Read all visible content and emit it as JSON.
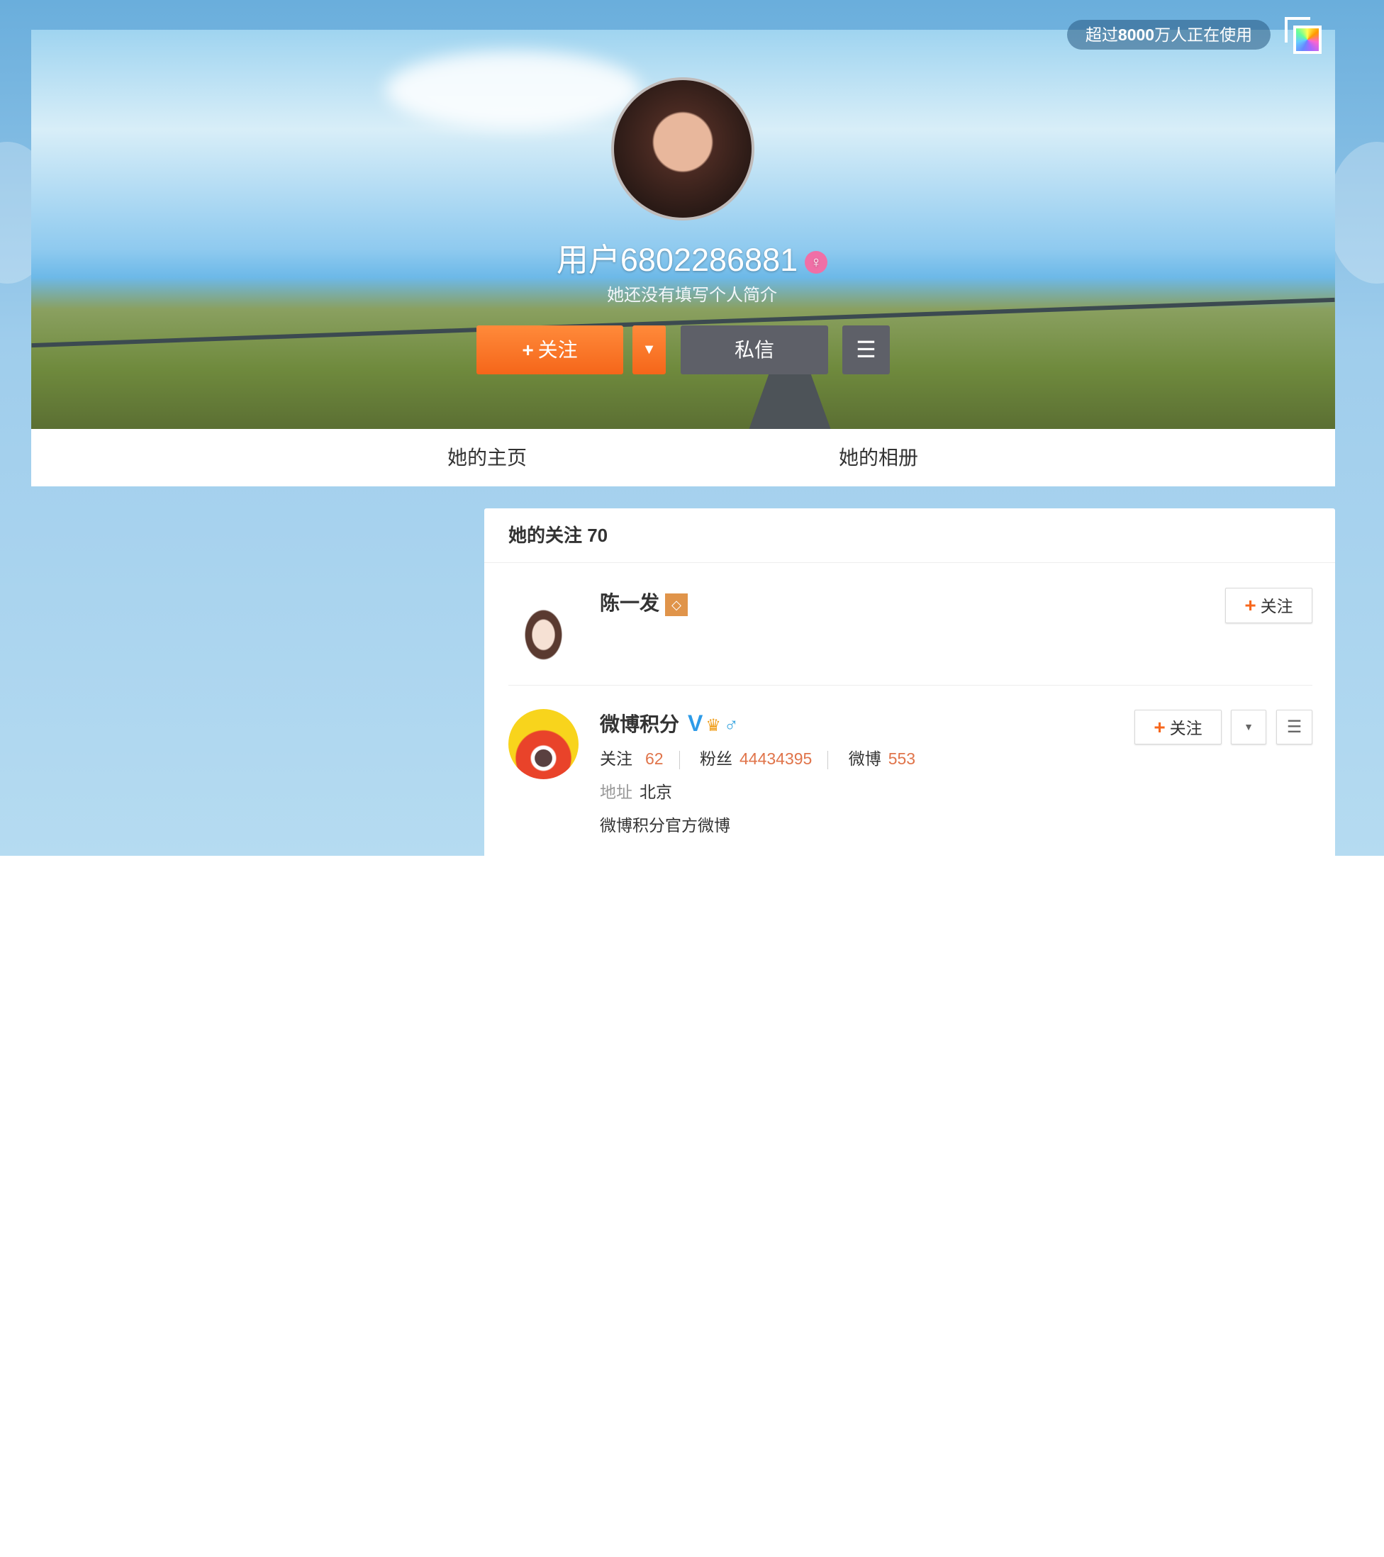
{
  "top": {
    "badge_prefix": "超过",
    "badge_count": "8000",
    "badge_suffix": "万人正在使用"
  },
  "profile": {
    "name": "用户6802286881",
    "gender": "♀",
    "bio": "她还没有填写个人简介",
    "follow_label": "关注",
    "message_label": "私信"
  },
  "tabs": [
    {
      "label": "她的主页"
    },
    {
      "label": "她的相册"
    }
  ],
  "following": {
    "title": "她的关注 70",
    "items": [
      {
        "name": "陈一发",
        "follow_label": "关注"
      },
      {
        "name": "微博积分",
        "verified": "V",
        "gender": "♂",
        "follow_label": "关注",
        "stats": [
          {
            "label": "关注",
            "value": "62"
          },
          {
            "label": "粉丝",
            "value": "44434395"
          },
          {
            "label": "微博",
            "value": "553"
          }
        ],
        "address_label": "地址",
        "address": "北京",
        "description": "微博积分官方微博"
      }
    ]
  },
  "colors": {
    "accent": "#f5661a",
    "number": "#e0744a"
  }
}
